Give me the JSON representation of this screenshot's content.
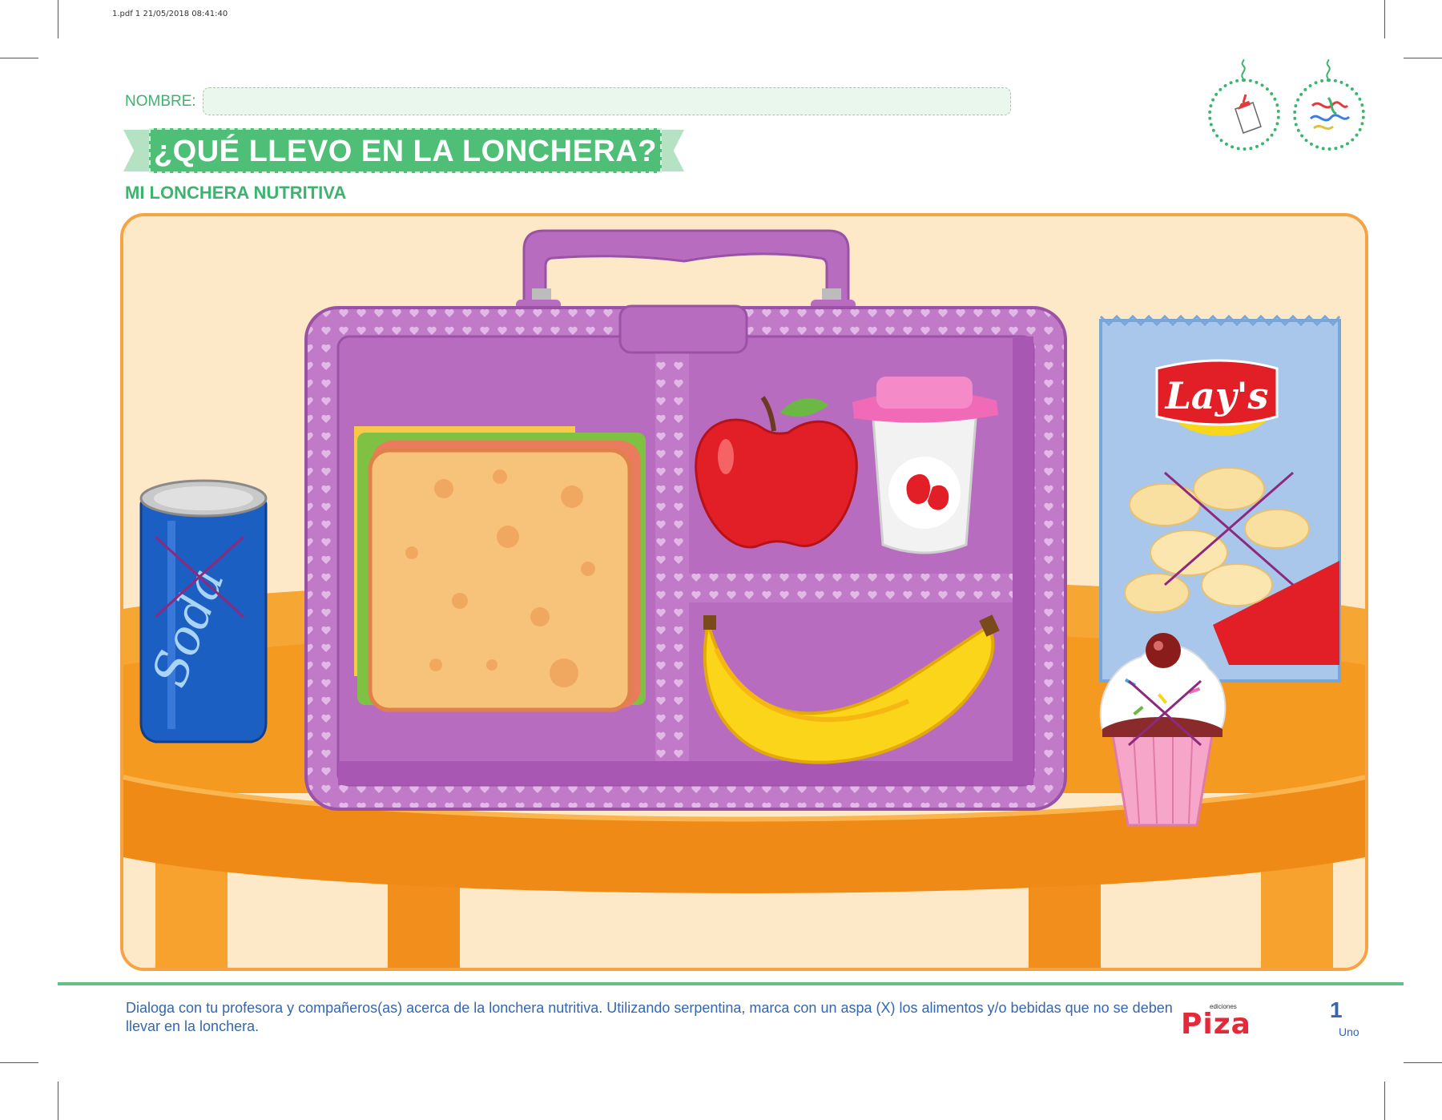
{
  "print_info": "1.pdf   1   21/05/2018   08:41:40",
  "header": {
    "name_label": "NOMBRE:",
    "title": "¿QUÉ LLEVO EN LA LONCHERA?",
    "subtitle": "MI LONCHERA NUTRITIVA",
    "icons": [
      "glue-bottle-icon",
      "streamer-icon"
    ]
  },
  "scene": {
    "items": [
      {
        "name": "soda-can",
        "label": "Soda",
        "crossed": true
      },
      {
        "name": "sandwich",
        "crossed": false
      },
      {
        "name": "apple",
        "crossed": false
      },
      {
        "name": "strawberry-yogurt",
        "crossed": false
      },
      {
        "name": "banana",
        "crossed": false
      },
      {
        "name": "chips-bag",
        "label": "Lay's",
        "crossed": true
      },
      {
        "name": "cupcake",
        "crossed": true
      }
    ],
    "colors": {
      "lunchbox": "#b86cbf",
      "table": "#f4961f",
      "wall": "#fde9c8",
      "cross": "#8e2a7e"
    }
  },
  "footer": {
    "instruction": "Dialoga con tu profesora y compañeros(as) acerca de la lonchera nutritiva. Utilizando serpentina, marca con un aspa (X) los alimentos y/o bebidas que no se deben llevar en la lonchera.",
    "brand_small": "ediciones",
    "brand": "Piza",
    "page_number": "1",
    "page_word": "Uno"
  }
}
